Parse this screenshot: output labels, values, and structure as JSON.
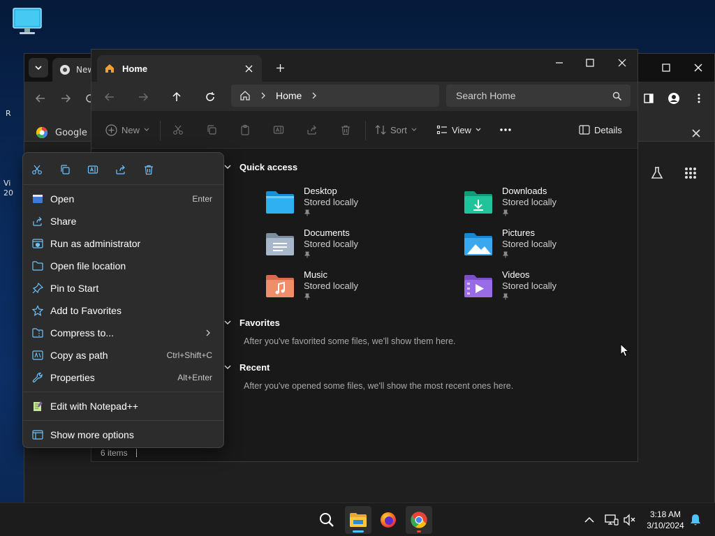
{
  "desktop": {
    "edge_text_1": "R",
    "edge_text_2": "Vi",
    "edge_text_3": "20"
  },
  "chrome": {
    "tab_title": "New",
    "bookmark_label": "Google"
  },
  "explorer": {
    "tab_title": "Home",
    "breadcrumb": [
      "Home"
    ],
    "search_placeholder": "Search Home",
    "commands": {
      "new_label": "New",
      "sort_label": "Sort",
      "view_label": "View",
      "details_label": "Details"
    },
    "sections": {
      "quick_access": "Quick access",
      "favorites": "Favorites",
      "favorites_empty": "After you've favorited some files, we'll show them here.",
      "recent": "Recent",
      "recent_empty": "After you've opened some files, we'll show the most recent ones here."
    },
    "quick_access_items": [
      {
        "name": "Desktop",
        "sub": "Stored locally",
        "icon": "desktop-folder-icon"
      },
      {
        "name": "Downloads",
        "sub": "Stored locally",
        "icon": "downloads-folder-icon"
      },
      {
        "name": "Documents",
        "sub": "Stored locally",
        "icon": "documents-folder-icon"
      },
      {
        "name": "Pictures",
        "sub": "Stored locally",
        "icon": "pictures-folder-icon"
      },
      {
        "name": "Music",
        "sub": "Stored locally",
        "icon": "music-folder-icon"
      },
      {
        "name": "Videos",
        "sub": "Stored locally",
        "icon": "videos-folder-icon"
      }
    ],
    "status": "6 items"
  },
  "context_menu": {
    "items": [
      {
        "label": "Open",
        "shortcut": "Enter",
        "icon": "open-app-icon"
      },
      {
        "label": "Share",
        "shortcut": "",
        "icon": "share-icon"
      },
      {
        "label": "Run as administrator",
        "shortcut": "",
        "icon": "admin-shield-icon"
      },
      {
        "label": "Open file location",
        "shortcut": "",
        "icon": "folder-icon"
      },
      {
        "label": "Pin to Start",
        "shortcut": "",
        "icon": "pin-icon"
      },
      {
        "label": "Add to Favorites",
        "shortcut": "",
        "icon": "star-icon"
      },
      {
        "label": "Compress to...",
        "shortcut": "",
        "icon": "compress-icon"
      },
      {
        "label": "Copy as path",
        "shortcut": "Ctrl+Shift+C",
        "icon": "copy-path-icon"
      },
      {
        "label": "Properties",
        "shortcut": "Alt+Enter",
        "icon": "wrench-icon"
      },
      {
        "label": "Edit with Notepad++",
        "shortcut": "",
        "icon": "notepadpp-icon"
      },
      {
        "label": "Show more options",
        "shortcut": "",
        "icon": "more-options-icon"
      }
    ]
  },
  "taskbar": {
    "time": "3:18 AM",
    "date": "3/10/2024"
  },
  "colors": {
    "explorer_bg": "#191919",
    "menu_bg": "#2c2c2c",
    "accent_blue": "#4cc2ff",
    "chrome_red": "#ea4335"
  }
}
